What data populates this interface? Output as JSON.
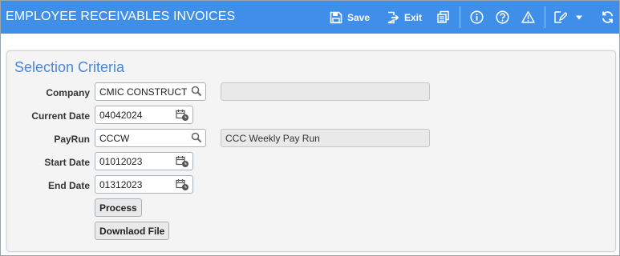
{
  "header": {
    "title": "EMPLOYEE RECEIVABLES INVOICES",
    "save_label": "Save",
    "exit_label": "Exit"
  },
  "section": {
    "title": "Selection Criteria"
  },
  "form": {
    "company": {
      "label": "Company",
      "value": "CMIC CONSTRUCT",
      "description": ""
    },
    "current_date": {
      "label": "Current Date",
      "value": "04042024"
    },
    "payrun": {
      "label": "PayRun",
      "value": "CCCW",
      "description": "CCC Weekly Pay Run"
    },
    "start_date": {
      "label": "Start Date",
      "value": "01012023"
    },
    "end_date": {
      "label": "End Date",
      "value": "01312023"
    }
  },
  "buttons": {
    "process_label": "Process",
    "download_label": "Downlaod File"
  },
  "colors": {
    "header_bg": "#3f8fe8",
    "section_title": "#4a87d6"
  }
}
